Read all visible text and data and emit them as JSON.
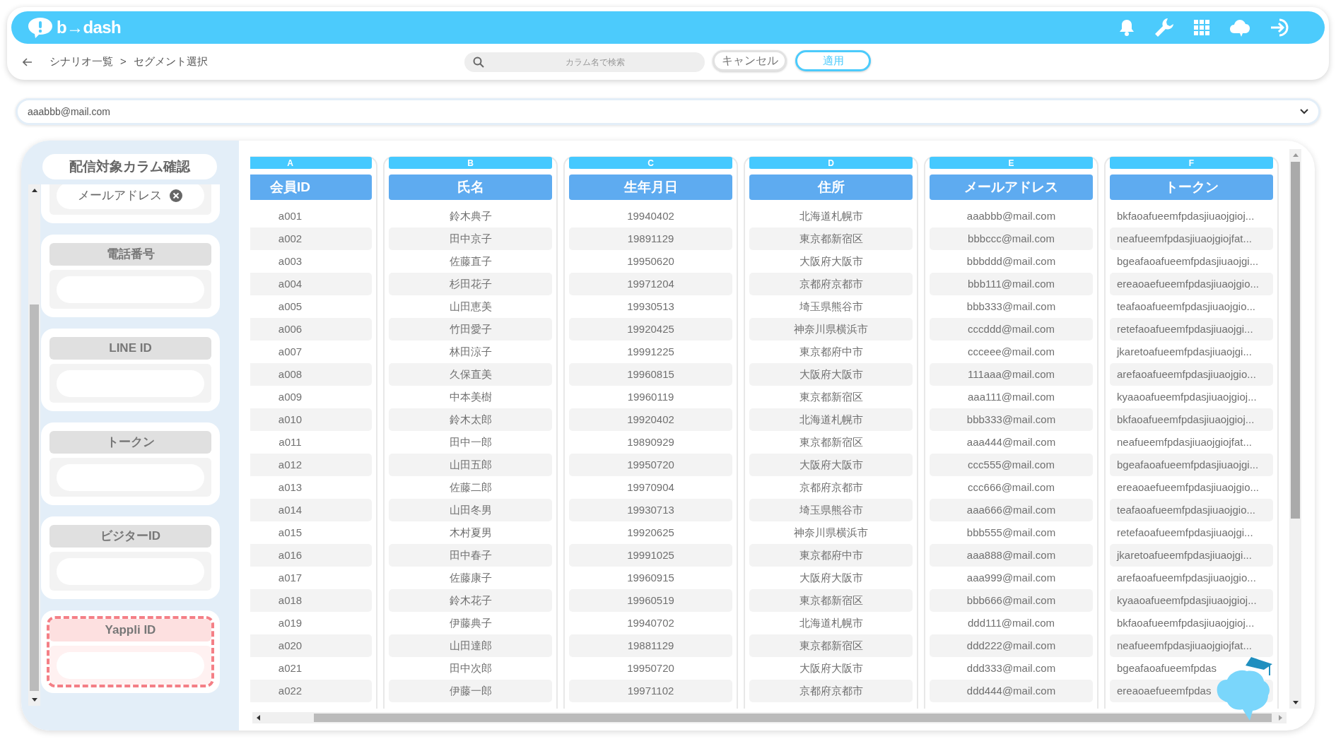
{
  "app": {
    "logo": "b→dash"
  },
  "breadcrumb": {
    "items": [
      "シナリオ一覧",
      "セグメント選択"
    ],
    "separator": ">"
  },
  "search": {
    "placeholder": "カラム名で検索"
  },
  "buttons": [
    {
      "label": "キャンセル",
      "kind": "secondary"
    },
    {
      "label": "適用",
      "kind": "primary"
    }
  ],
  "email_select": {
    "value": "aaabbb@mail.com"
  },
  "column_panel": {
    "title": "配信対象カラム確認",
    "slots": [
      {
        "value": "メールアドレス",
        "highlighted": false
      },
      {
        "label": "電話番号",
        "highlighted": false
      },
      {
        "label": "LINE ID",
        "highlighted": false
      },
      {
        "label": "トークン",
        "highlighted": false
      },
      {
        "label": "ビジターID",
        "highlighted": false
      },
      {
        "label": "Yappli ID",
        "highlighted": true
      }
    ]
  },
  "table": {
    "columns": [
      {
        "letter": "A",
        "title": "会員ID",
        "kind": "text"
      },
      {
        "letter": "B",
        "title": "氏名",
        "kind": "text"
      },
      {
        "letter": "C",
        "title": "生年月日",
        "kind": "text"
      },
      {
        "letter": "D",
        "title": "住所",
        "kind": "text"
      },
      {
        "letter": "E",
        "title": "メールアドレス",
        "kind": "text"
      },
      {
        "letter": "F",
        "title": "トークン",
        "kind": "token"
      }
    ],
    "rows": [
      [
        "a001",
        "鈴木典子",
        "19940402",
        "北海道札幌市",
        "aaabbb@mail.com",
        "bkfaoafueemfpdasjiuaojgioj..."
      ],
      [
        "a002",
        "田中京子",
        "19891129",
        "東京都新宿区",
        "bbbccc@mail.com",
        "neafueemfpdasjiuaojgiojfat..."
      ],
      [
        "a003",
        "佐藤直子",
        "19950620",
        "大阪府大阪市",
        "bbbddd@mail.com",
        "bgeafaoafueemfpdasjiuaojgi..."
      ],
      [
        "a004",
        "杉田花子",
        "19971204",
        "京都府京都市",
        "bbb111@mail.com",
        "ereaoaefueemfpdasjiuaojgio..."
      ],
      [
        "a005",
        "山田恵美",
        "19930513",
        "埼玉県熊谷市",
        "bbb333@mail.com",
        "teafaoafueemfpdasjiuaojgio..."
      ],
      [
        "a006",
        "竹田愛子",
        "19920425",
        "神奈川県横浜市",
        "cccddd@mail.com",
        "retefaoafueemfpdasjiuaojgi..."
      ],
      [
        "a007",
        "林田涼子",
        "19991225",
        "東京都府中市",
        "ccceee@mail.com",
        "jkaretoafueemfpdasjiuaojgi..."
      ],
      [
        "a008",
        "久保直美",
        "19960815",
        "大阪府大阪市",
        "111aaa@mail.com",
        "arefaoafueemfpdasjiuaojgio..."
      ],
      [
        "a009",
        "中本美樹",
        "19960119",
        "東京都新宿区",
        "aaa111@mail.com",
        "kyaaoafueemfpdasjiuaojgioj..."
      ],
      [
        "a010",
        "鈴木太郎",
        "19920402",
        "北海道札幌市",
        "bbb333@mail.com",
        "bkfaoafueemfpdasjiuaojgioj..."
      ],
      [
        "a011",
        "田中一郎",
        "19890929",
        "東京都新宿区",
        "aaa444@mail.com",
        "neafueemfpdasjiuaojgiojfat..."
      ],
      [
        "a012",
        "山田五郎",
        "19950720",
        "大阪府大阪市",
        "ccc555@mail.com",
        "bgeafaoafueemfpdasjiuaojgi..."
      ],
      [
        "a013",
        "佐藤二郎",
        "19970904",
        "京都府京都市",
        "ccc666@mail.com",
        "ereaoaefueemfpdasjiuaojgio..."
      ],
      [
        "a014",
        "山田冬男",
        "19930713",
        "埼玉県熊谷市",
        "aaa666@mail.com",
        "teafaoafueemfpdasjiuaojgio..."
      ],
      [
        "a015",
        "木村夏男",
        "19920625",
        "神奈川県横浜市",
        "bbb555@mail.com",
        "retefaoafueemfpdasjiuaojgi..."
      ],
      [
        "a016",
        "田中春子",
        "19991025",
        "東京都府中市",
        "aaa888@mail.com",
        "jkaretoafueemfpdasjiuaojgi..."
      ],
      [
        "a017",
        "佐藤康子",
        "19960915",
        "大阪府大阪市",
        "aaa999@mail.com",
        "arefaoafueemfpdasjiuaojgio..."
      ],
      [
        "a018",
        "鈴木花子",
        "19960519",
        "東京都新宿区",
        "bbb666@mail.com",
        "kyaaoafueemfpdasjiuaojgioj..."
      ],
      [
        "a019",
        "伊藤典子",
        "19940702",
        "北海道札幌市",
        "ddd111@mail.com",
        "bkfaoafueemfpdasjiuaojgioj..."
      ],
      [
        "a020",
        "山田達郎",
        "19881129",
        "東京都新宿区",
        "ddd222@mail.com",
        "neafueemfpdasjiuaojgiojfat..."
      ],
      [
        "a021",
        "田中次郎",
        "19950720",
        "大阪府大阪市",
        "ddd333@mail.com",
        "bgeafaoafueemfpdas"
      ],
      [
        "a022",
        "伊藤一郎",
        "19971102",
        "京都府京都市",
        "ddd444@mail.com",
        "ereaoaefueemfpdas"
      ]
    ]
  }
}
